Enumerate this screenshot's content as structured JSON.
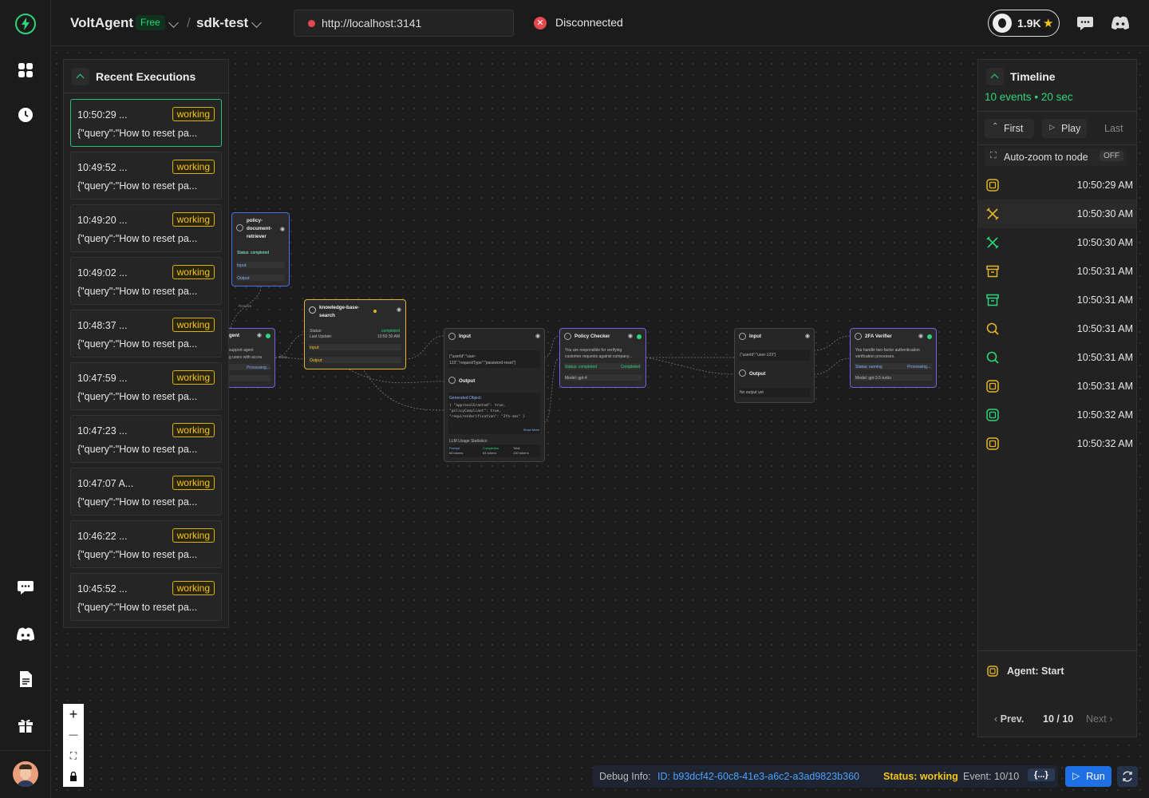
{
  "app": {
    "brand": "VoltAgent",
    "plan_badge": "Free",
    "project": "sdk-test",
    "server_url": "http://localhost:3141",
    "connection_status": "Disconnected",
    "github_stars": "1.9K"
  },
  "colors": {
    "accent": "#2ed47a",
    "warning": "#f5c518",
    "error": "#e5484d",
    "primary": "#1f6fe5"
  },
  "recent": {
    "title": "Recent Executions",
    "items": [
      {
        "time": "10:50:29 ...",
        "status": "working",
        "query": "{\"query\":\"How to reset pa..."
      },
      {
        "time": "10:49:52 ...",
        "status": "working",
        "query": "{\"query\":\"How to reset pa..."
      },
      {
        "time": "10:49:20 ...",
        "status": "working",
        "query": "{\"query\":\"How to reset pa..."
      },
      {
        "time": "10:49:02 ...",
        "status": "working",
        "query": "{\"query\":\"How to reset pa..."
      },
      {
        "time": "10:48:37 ...",
        "status": "working",
        "query": "{\"query\":\"How to reset pa..."
      },
      {
        "time": "10:47:59 ...",
        "status": "working",
        "query": "{\"query\":\"How to reset pa..."
      },
      {
        "time": "10:47:23 ...",
        "status": "working",
        "query": "{\"query\":\"How to reset pa..."
      },
      {
        "time": "10:47:07 A...",
        "status": "working",
        "query": "{\"query\":\"How to reset pa..."
      },
      {
        "time": "10:46:22 ...",
        "status": "working",
        "query": "{\"query\":\"How to reset pa..."
      },
      {
        "time": "10:45:52 ...",
        "status": "working",
        "query": "{\"query\":\"How to reset pa..."
      }
    ]
  },
  "nodes": {
    "policy_retriever": {
      "title": "policy-document-retriever",
      "status": "Status: completed",
      "input": "Input:",
      "output": "Output:"
    },
    "agent": {
      "title": "gent",
      "line1": "support agent",
      "line2": "g users with accou",
      "status": "Processing..."
    },
    "kb_search": {
      "title": "knowledge-base-search",
      "status_label": "Status:",
      "status_value": "completed",
      "update_label": "Last Update:",
      "update_value": "10:50:30 AM",
      "input": "Input:",
      "output": "Output:"
    },
    "io1": {
      "input": "Input",
      "input_value": "{\"userId\":\"user-123\",\"requestType\":\"password-reset\"}",
      "output": "Output",
      "generated": "Generated Object:",
      "code": "{ \"approvalGranted\": true, \"policyCompliant\": true, \"requiresVerification\": \"2fa-sms\" }",
      "show_more": "Show More",
      "usage": "LLM Usage Statistics:",
      "prompt": "Prompt",
      "prompt_v": "66 tokens",
      "completion": "Completion",
      "completion_v": "64 tokens",
      "total": "Total",
      "total_v": "130 tokens"
    },
    "policy_checker": {
      "title": "Policy Checker",
      "line1": "You are responsible for verifying",
      "line2": "customer requests against company...",
      "status": "Status: completed",
      "status2": "Completed",
      "model": "Model: gpt-4"
    },
    "io2": {
      "input": "Input",
      "input_value": "{\"userId\":\"user-123\"}",
      "output": "Output",
      "output_value": "No output yet"
    },
    "verifier": {
      "title": "2FA Verifier",
      "line1": "You handle two-factor authentication",
      "line2": "verification processes.",
      "status": "Status: running",
      "status2": "Processing...",
      "model": "Model: gpt-3.5-turbo"
    }
  },
  "edge_labels": {
    "e1": "Resolve",
    "e2": "Tools"
  },
  "timeline": {
    "title": "Timeline",
    "summary_events": "10 events",
    "summary_sep": "•",
    "summary_duration": "20 sec",
    "first": "First",
    "play": "Play",
    "last": "Last",
    "autozoom": "Auto-zoom to node",
    "autozoom_state": "OFF",
    "events": [
      {
        "time": "10:50:29 AM",
        "icon": "chip-icon",
        "color": "#e0b52b"
      },
      {
        "time": "10:50:30 AM",
        "icon": "tools-icon",
        "color": "#e0b52b"
      },
      {
        "time": "10:50:30 AM",
        "icon": "tools-icon",
        "color": "#2ed47a"
      },
      {
        "time": "10:50:31 AM",
        "icon": "archive-icon",
        "color": "#e0b52b"
      },
      {
        "time": "10:50:31 AM",
        "icon": "archive-icon",
        "color": "#2ed47a"
      },
      {
        "time": "10:50:31 AM",
        "icon": "search-icon",
        "color": "#e0b52b"
      },
      {
        "time": "10:50:31 AM",
        "icon": "search-icon",
        "color": "#2ed47a"
      },
      {
        "time": "10:50:31 AM",
        "icon": "chip-icon",
        "color": "#e0b52b"
      },
      {
        "time": "10:50:32 AM",
        "icon": "chip-icon",
        "color": "#2ed47a"
      },
      {
        "time": "10:50:32 AM",
        "icon": "chip-icon",
        "color": "#e0b52b"
      }
    ],
    "selected": "Agent: Start",
    "prev": "Prev.",
    "position": "10 / 10",
    "next": "Next"
  },
  "zoom": {
    "in": "+",
    "out": "—"
  },
  "debug": {
    "label": "Debug Info:",
    "id": "ID: b93dcf42-60c8-41e3-a6c2-a3ad9823b360",
    "status": "Status: working",
    "event": "Event: 10/10",
    "json": "{...}"
  },
  "run": "Run"
}
